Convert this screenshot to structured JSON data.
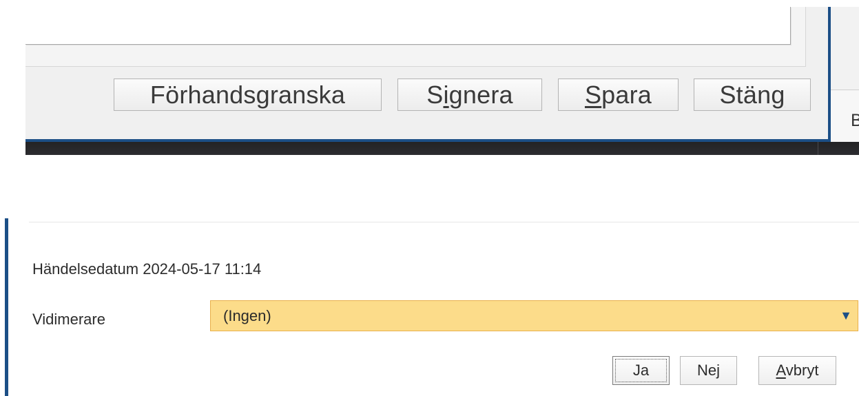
{
  "top_dialog": {
    "buttons": {
      "preview": {
        "label": "Förhandsgranska"
      },
      "sign": {
        "pre": "S",
        "mnemonic": "i",
        "post": "gnera"
      },
      "save": {
        "pre": "",
        "mnemonic": "S",
        "post": "para"
      },
      "close": {
        "pre": "Stän",
        "mnemonic": "g",
        "post": ""
      }
    },
    "side_fragment": "B"
  },
  "bottom_dialog": {
    "event_date_text": "Händelsedatum 2024-05-17 11:14",
    "witness_label": "Vidimerare",
    "witness_select": {
      "value": "(Ingen)",
      "icon": "dropdown-arrow-icon"
    },
    "buttons": {
      "yes": {
        "label": "Ja"
      },
      "no": {
        "label": "Nej"
      },
      "cancel": {
        "pre": "",
        "mnemonic": "A",
        "post": "vbryt"
      }
    }
  },
  "colors": {
    "accent": "#1c4f86",
    "select_bg": "#fcdc8a",
    "select_border": "#e8b04a"
  }
}
